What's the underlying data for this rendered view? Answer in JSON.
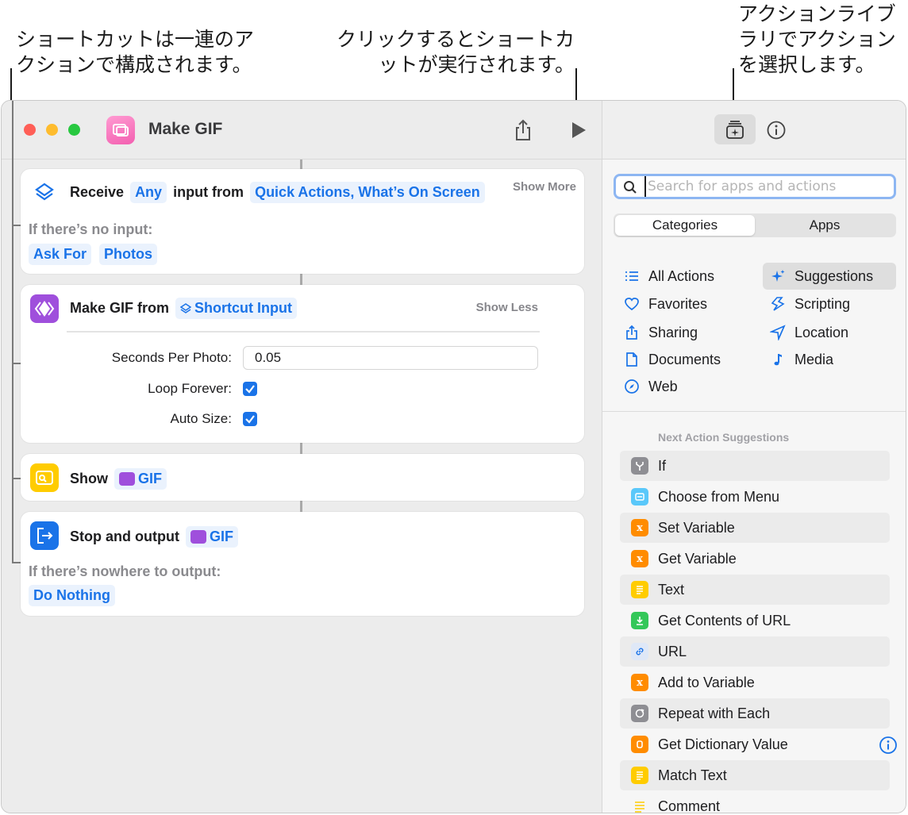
{
  "callouts": {
    "left": [
      "ショートカットは一連のア",
      "クションで構成されます。"
    ],
    "middle": [
      "クリックするとショートカ",
      "ットが実行されます。"
    ],
    "right": [
      "アクションライブ",
      "ラリでアクション",
      "を選択します。"
    ]
  },
  "window": {
    "title": "Make GIF"
  },
  "actions": {
    "receive": {
      "verb": "Receive",
      "type_token": "Any",
      "connector": "input from",
      "source_token": "Quick Actions, What’s On Screen",
      "toggle": "Show More",
      "no_input_label": "If there’s no input:",
      "options": [
        "Ask For",
        "Photos"
      ]
    },
    "make_gif": {
      "verb": "Make GIF from",
      "input_token": "Shortcut Input",
      "toggle": "Show Less",
      "params": {
        "seconds_label": "Seconds Per Photo:",
        "seconds_value": "0.05",
        "loop_label": "Loop Forever:",
        "loop_checked": true,
        "autosize_label": "Auto Size:",
        "autosize_checked": true
      }
    },
    "show": {
      "verb": "Show",
      "token": "GIF"
    },
    "stop": {
      "verb": "Stop and output",
      "token": "GIF",
      "nowhere_label": "If there’s nowhere to output:",
      "option": "Do Nothing"
    }
  },
  "library": {
    "search_placeholder": "Search for apps and actions",
    "search_value": "",
    "segments": [
      "Categories",
      "Apps"
    ],
    "selected_segment": "Categories",
    "categories_left": [
      "All Actions",
      "Favorites",
      "Sharing",
      "Documents",
      "Web"
    ],
    "categories_right": [
      "Suggestions",
      "Scripting",
      "Location",
      "Media"
    ],
    "selected_category": "Suggestions",
    "suggestions_heading": "Next Action Suggestions",
    "suggestions": [
      {
        "label": "If",
        "color": "#8e8e93"
      },
      {
        "label": "Choose from Menu",
        "color": "#5ac8fa"
      },
      {
        "label": "Set Variable",
        "color": "#ff8c00"
      },
      {
        "label": "Get Variable",
        "color": "#ff8c00"
      },
      {
        "label": "Text",
        "color": "#ffcc00"
      },
      {
        "label": "Get Contents of URL",
        "color": "#34c759"
      },
      {
        "label": "URL",
        "color": "#dfe8f7"
      },
      {
        "label": "Add to Variable",
        "color": "#ff8c00"
      },
      {
        "label": "Repeat with Each",
        "color": "#8e8e93"
      },
      {
        "label": "Get Dictionary Value",
        "color": "#ff8c00"
      },
      {
        "label": "Match Text",
        "color": "#ffcc00"
      },
      {
        "label": "Comment",
        "color": "#ffcc00"
      }
    ]
  },
  "colors": {
    "accent": "#1a73e8",
    "token_bg": "#eaf2fd",
    "gif_purple": "#9f4fdc",
    "traffic_red": "#ff5f57",
    "traffic_yellow": "#febc2e",
    "traffic_green": "#28c840"
  }
}
